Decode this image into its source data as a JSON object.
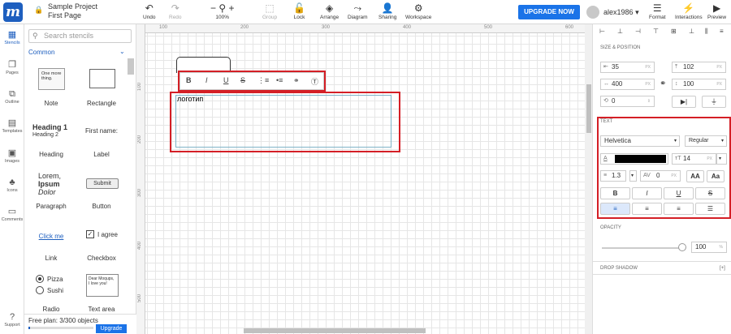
{
  "app": {
    "logo_letter": "m",
    "project": "Sample Project",
    "page": "First Page"
  },
  "toolbar": {
    "undo": "Undo",
    "redo": "Redo",
    "zoom": "100%",
    "group": "Group",
    "lock": "Lock",
    "arrange": "Arrange",
    "diagram": "Diagram",
    "sharing": "Sharing",
    "workspace": "Workspace",
    "upgrade": "UPGRADE NOW",
    "user": "alex1986",
    "format": "Format",
    "interactions": "Interactions",
    "preview": "Preview"
  },
  "rail": [
    {
      "label": "Stencils",
      "icon": "stencils-icon",
      "active": true
    },
    {
      "label": "Pages",
      "icon": "pages-icon"
    },
    {
      "label": "Outline",
      "icon": "outline-icon"
    },
    {
      "label": "Templates",
      "icon": "templates-icon"
    },
    {
      "label": "Images",
      "icon": "images-icon"
    },
    {
      "label": "Icons",
      "icon": "icons-icon"
    },
    {
      "label": "Comments",
      "icon": "comments-icon"
    },
    {
      "label": "Support",
      "icon": "support-icon"
    }
  ],
  "stencils": {
    "search_placeholder": "Search stencils",
    "section": "Common",
    "items": [
      {
        "label": "Note",
        "preview": "One more thing."
      },
      {
        "label": "Rectangle"
      },
      {
        "label": "Heading",
        "preview": "Heading 1",
        "preview2": "Heading 2"
      },
      {
        "label": "Label",
        "preview": "First name:"
      },
      {
        "label": "Paragraph",
        "preview": "Lorem,",
        "preview2": "Ipsum",
        "preview3": "Dolor"
      },
      {
        "label": "Button",
        "preview": "Submit"
      },
      {
        "label": "Link",
        "preview": "Click me"
      },
      {
        "label": "Checkbox",
        "preview": "I agree"
      },
      {
        "label": "Radio",
        "preview": "Pizza",
        "preview2": "Sushi"
      },
      {
        "label": "Text area",
        "preview": "Dear Moqups,",
        "preview2": "I love you!"
      }
    ],
    "free_plan": "Free plan: 3/300 objects",
    "upgrade": "Upgrade"
  },
  "rulers": {
    "h": [
      "100",
      "200",
      "300",
      "400",
      "500",
      "600"
    ],
    "v": [
      "100",
      "200",
      "300",
      "400",
      "500"
    ]
  },
  "canvas": {
    "text_content": "логотип"
  },
  "text_toolbar": {
    "bold": "B",
    "italic": "I",
    "underline": "U",
    "strike": "S"
  },
  "props": {
    "size_position": "SIZE & POSITION",
    "x": "35",
    "y": "102",
    "w": "400",
    "h": "100",
    "rotation": "0",
    "unit": "PX",
    "text_section": "TEXT",
    "font": "Helvetica",
    "weight": "Regular",
    "color": "#000000",
    "font_size": "14",
    "line_height": "1.3",
    "letter_spacing": "0",
    "case_upper": "AA",
    "case_small": "Aa",
    "style_b": "B",
    "style_i": "I",
    "style_u": "U",
    "style_s": "S",
    "opacity_section": "OPACITY",
    "opacity": "100",
    "opacity_unit": "%",
    "shadow_section": "DROP SHADOW",
    "shadow_add": "[+]"
  },
  "colors": {
    "accent": "#1e5fbf",
    "upgrade": "#1a73e8",
    "highlight": "#d41f26"
  }
}
